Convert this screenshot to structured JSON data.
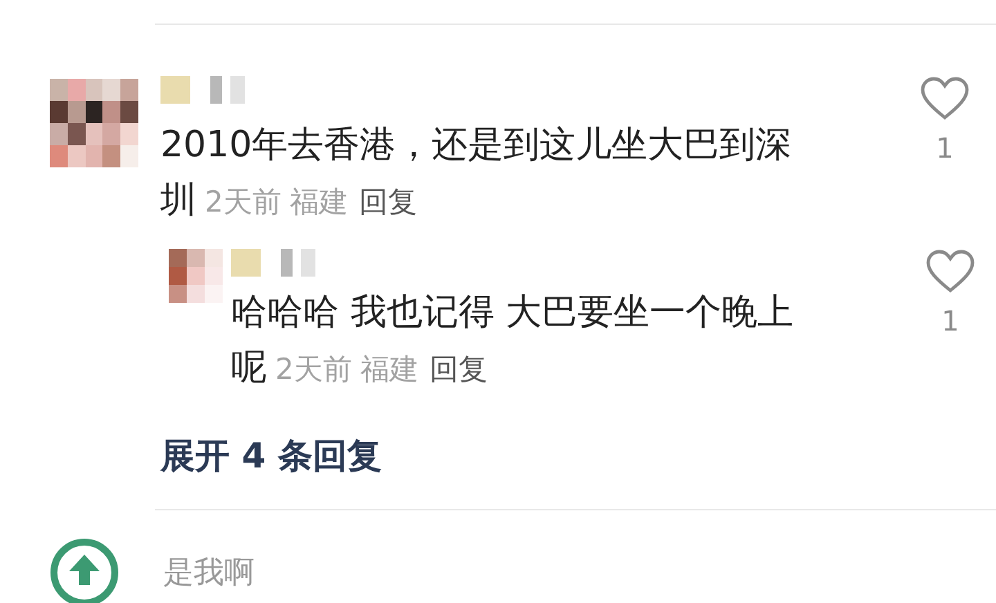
{
  "comments": [
    {
      "avatar": {
        "kind": "pixelated"
      },
      "text": "2010年去香港，还是到这儿坐大巴到深圳",
      "time": "2天前",
      "location": "福建",
      "reply_label": "回复",
      "likes": "1",
      "replies": [
        {
          "avatar": {
            "kind": "pixelated"
          },
          "text": "哈哈哈 我也记得 大巴要坐一个晚上呢",
          "time": "2天前",
          "location": "福建",
          "reply_label": "回复",
          "likes": "1"
        }
      ],
      "expand_label": "展开 4 条回复"
    },
    {
      "avatar": {
        "kind": "logo"
      },
      "name": "是我啊"
    }
  ]
}
